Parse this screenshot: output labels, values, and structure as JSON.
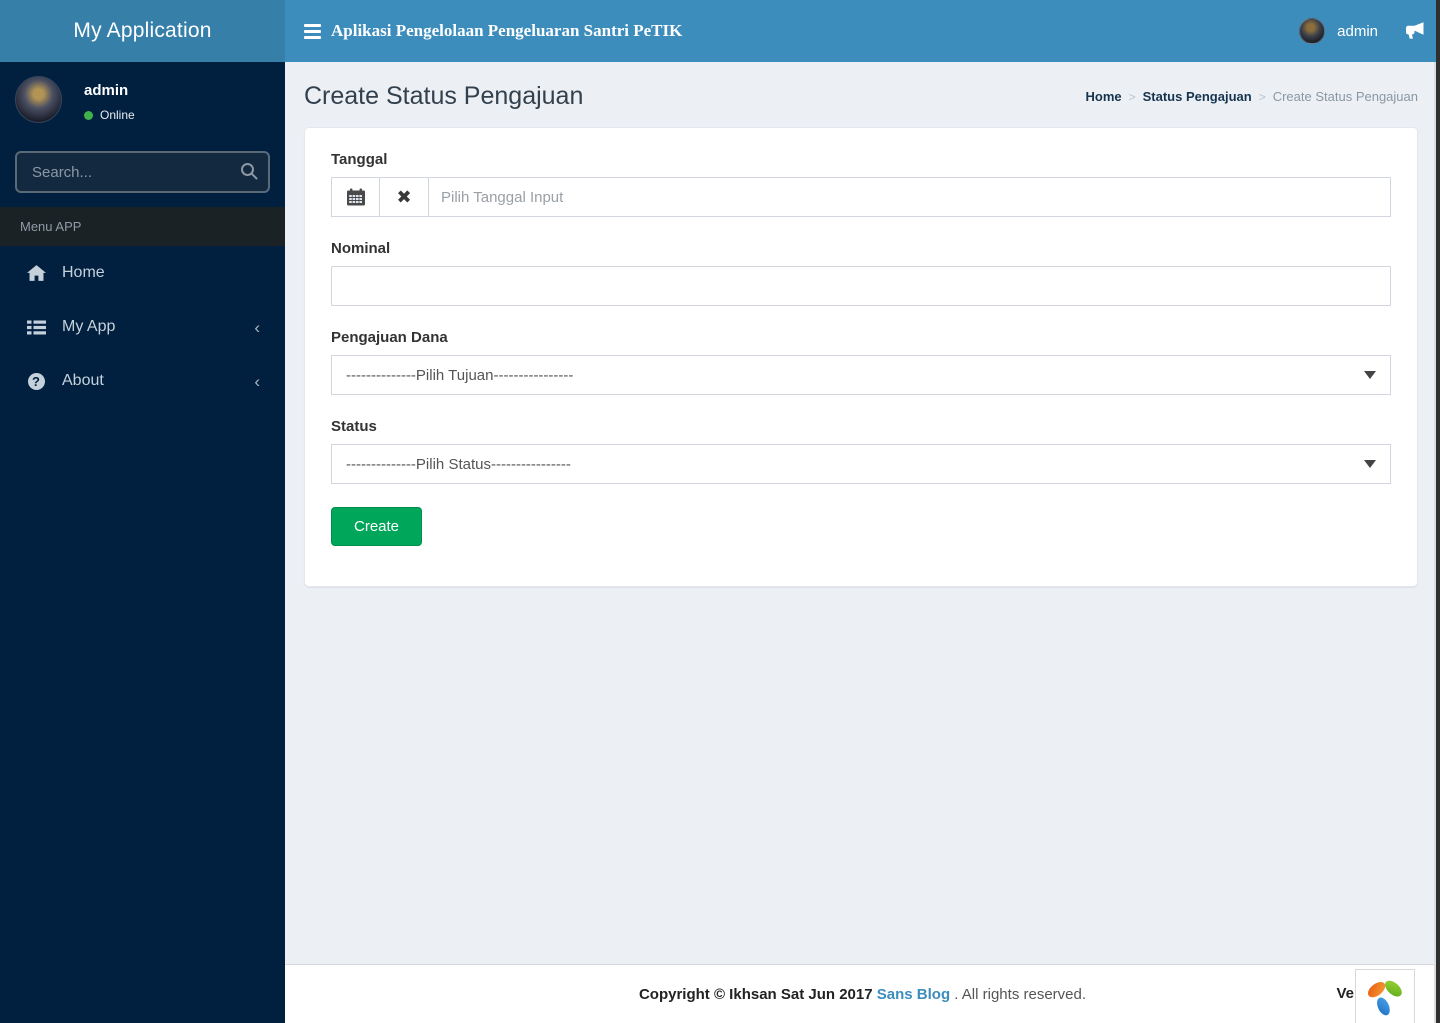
{
  "header": {
    "brand": "My Application",
    "app_title": "Aplikasi Pengelolaan Pengeluaran Santri PeTIK",
    "user_name": "admin"
  },
  "sidebar": {
    "user": {
      "name": "admin",
      "status": "Online"
    },
    "search_placeholder": "Search...",
    "section_label": "Menu APP",
    "items": [
      {
        "label": "Home",
        "icon": "home-icon",
        "has_children": false
      },
      {
        "label": "My App",
        "icon": "list-icon",
        "has_children": true
      },
      {
        "label": "About",
        "icon": "question-icon",
        "has_children": true
      }
    ],
    "collapse_glyph": "‹"
  },
  "page": {
    "title": "Create Status Pengajuan",
    "breadcrumb": [
      {
        "label": "Home",
        "active": false
      },
      {
        "label": "Status Pengajuan",
        "active": false
      },
      {
        "label": "Create Status Pengajuan",
        "active": true
      }
    ]
  },
  "form": {
    "tanggal": {
      "label": "Tanggal",
      "placeholder": "Pilih Tanggal Input",
      "value": ""
    },
    "nominal": {
      "label": "Nominal",
      "value": "",
      "placeholder": ""
    },
    "pengajuan_dana": {
      "label": "Pengajuan Dana",
      "selected": "--------------Pilih Tujuan----------------"
    },
    "status": {
      "label": "Status",
      "selected": "--------------Pilih Status----------------"
    },
    "submit_label": "Create"
  },
  "footer": {
    "copyright_bold": "Copyright © Ikhsan Sat Jun 2017",
    "link_label": "Sans Blog",
    "rest": " . All rights reserved.",
    "version_partial": "Ve"
  },
  "colors": {
    "navbar": "#3c8dbc",
    "logo_bg": "#367fa9",
    "sidebar_bg": "#011f3e",
    "section_bg": "#1a2226",
    "content_bg": "#ecf0f5",
    "success_button": "#00a65a",
    "online_dot": "#3db34a",
    "link": "#3c8dbc"
  }
}
